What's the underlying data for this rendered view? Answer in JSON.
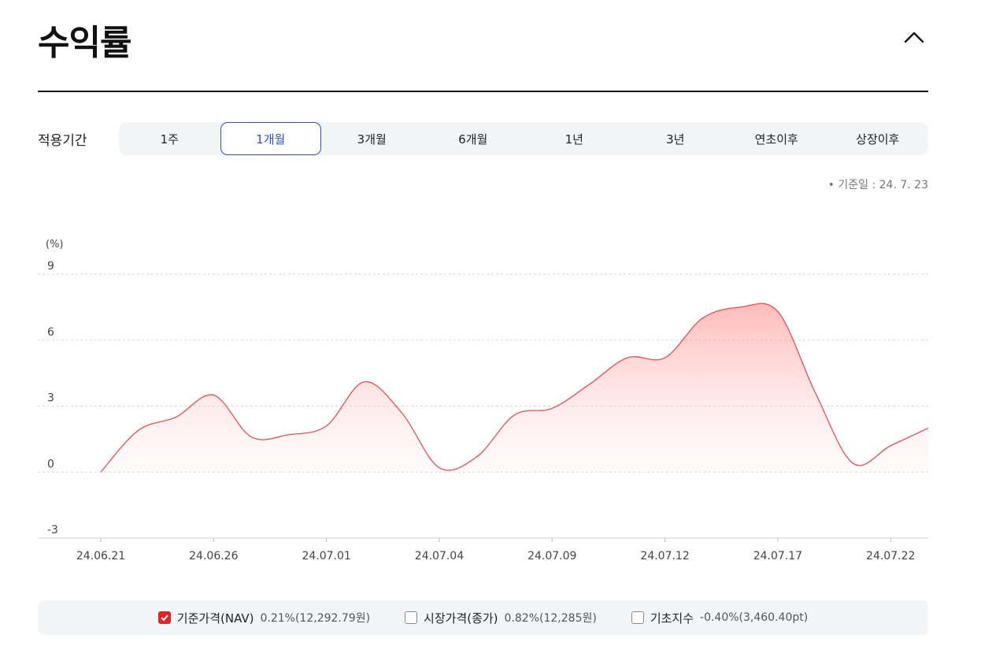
{
  "page": {
    "title": "수익률"
  },
  "period": {
    "label": "적용기간",
    "tabs": [
      "1주",
      "1개월",
      "3개월",
      "6개월",
      "1년",
      "3년",
      "연초이후",
      "상장이후"
    ],
    "active_index": 1
  },
  "base_date": "기준일 : 24. 7. 23",
  "colors": {
    "line": "#e85050",
    "accent": "#2a4fcc",
    "checkbox": "#e02525"
  },
  "chart_data": {
    "type": "area",
    "unit_label": "(%)",
    "ylim": [
      -3,
      9
    ],
    "yticks": [
      "9",
      "6",
      "3",
      "0",
      "-3"
    ],
    "x_ticks": [
      "24.06.21",
      "24.06.26",
      "24.07.01",
      "24.07.04",
      "24.07.09",
      "24.07.12",
      "24.07.17",
      "24.07.22"
    ],
    "grid": true,
    "x": [
      "24.06.21",
      "24.06.24",
      "24.06.25",
      "24.06.26",
      "24.06.27",
      "24.06.28",
      "24.07.01",
      "24.07.02",
      "24.07.03",
      "24.07.04",
      "24.07.05",
      "24.07.08",
      "24.07.09",
      "24.07.10",
      "24.07.11",
      "24.07.12",
      "24.07.15",
      "24.07.16",
      "24.07.17",
      "24.07.18",
      "24.07.19",
      "24.07.22",
      "24.07.23"
    ],
    "series": [
      {
        "name": "기준가격(NAV)",
        "values": [
          0.0,
          1.9,
          2.5,
          3.5,
          1.6,
          1.7,
          2.1,
          4.1,
          2.7,
          0.2,
          0.7,
          2.6,
          2.9,
          4.0,
          5.2,
          5.2,
          7.0,
          7.5,
          7.3,
          3.6,
          0.4,
          1.2,
          2.0
        ]
      }
    ]
  },
  "legend": [
    {
      "name": "기준가격(NAV)",
      "value": "0.21%(12,292.79원)",
      "checked": true
    },
    {
      "name": "시장가격(종가)",
      "value": "0.82%(12,285원)",
      "checked": false
    },
    {
      "name": "기초지수",
      "value": "-0.40%(3,460.40pt)",
      "checked": false
    }
  ]
}
